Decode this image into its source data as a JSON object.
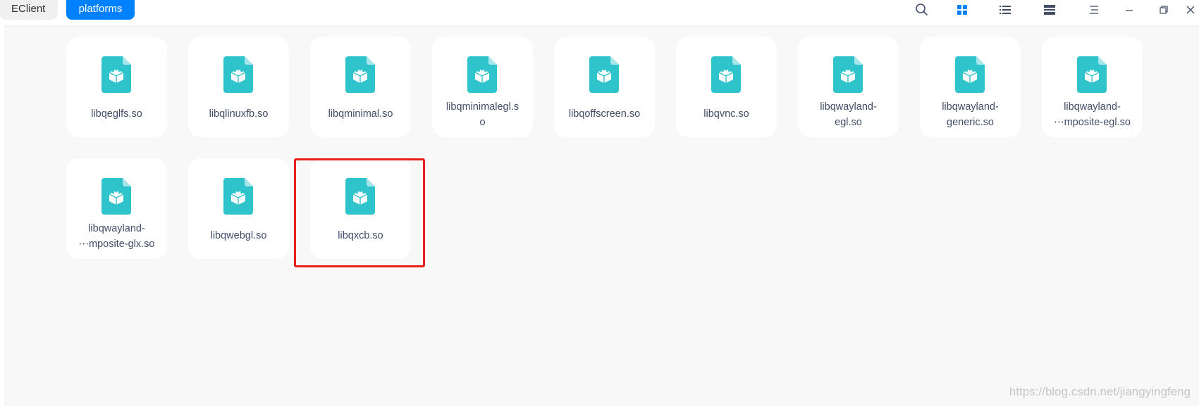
{
  "breadcrumb": {
    "items": [
      {
        "label": "EClient"
      },
      {
        "label": "platforms"
      }
    ]
  },
  "toolbar": {
    "icons": [
      "search-icon",
      "icon-view-icon",
      "list-view-icon",
      "detail-view-icon",
      "menu-icon",
      "minimize-icon",
      "maximize-icon",
      "close-icon"
    ]
  },
  "files": [
    {
      "name": "libqeglfs.so"
    },
    {
      "name": "libqlinuxfb.so"
    },
    {
      "name": "libqminimal.so"
    },
    {
      "name": "libqminimalegl.s\no"
    },
    {
      "name": "libqoffscreen.so"
    },
    {
      "name": "libqvnc.so"
    },
    {
      "name": "libqwayland-\negl.so"
    },
    {
      "name": "libqwayland-\ngeneric.so"
    },
    {
      "name": "libqwayland-\n⋯mposite-egl.so"
    },
    {
      "name": "libqwayland-\n⋯mposite-glx.so"
    },
    {
      "name": "libqwebgl.so"
    },
    {
      "name": "libqxcb.so"
    }
  ],
  "watermark": "https://blog.csdn.net/jiangyingfeng",
  "colors": {
    "accent": "#0081ff",
    "file_icon": "#2fc4cc",
    "highlight": "#e8201c"
  }
}
